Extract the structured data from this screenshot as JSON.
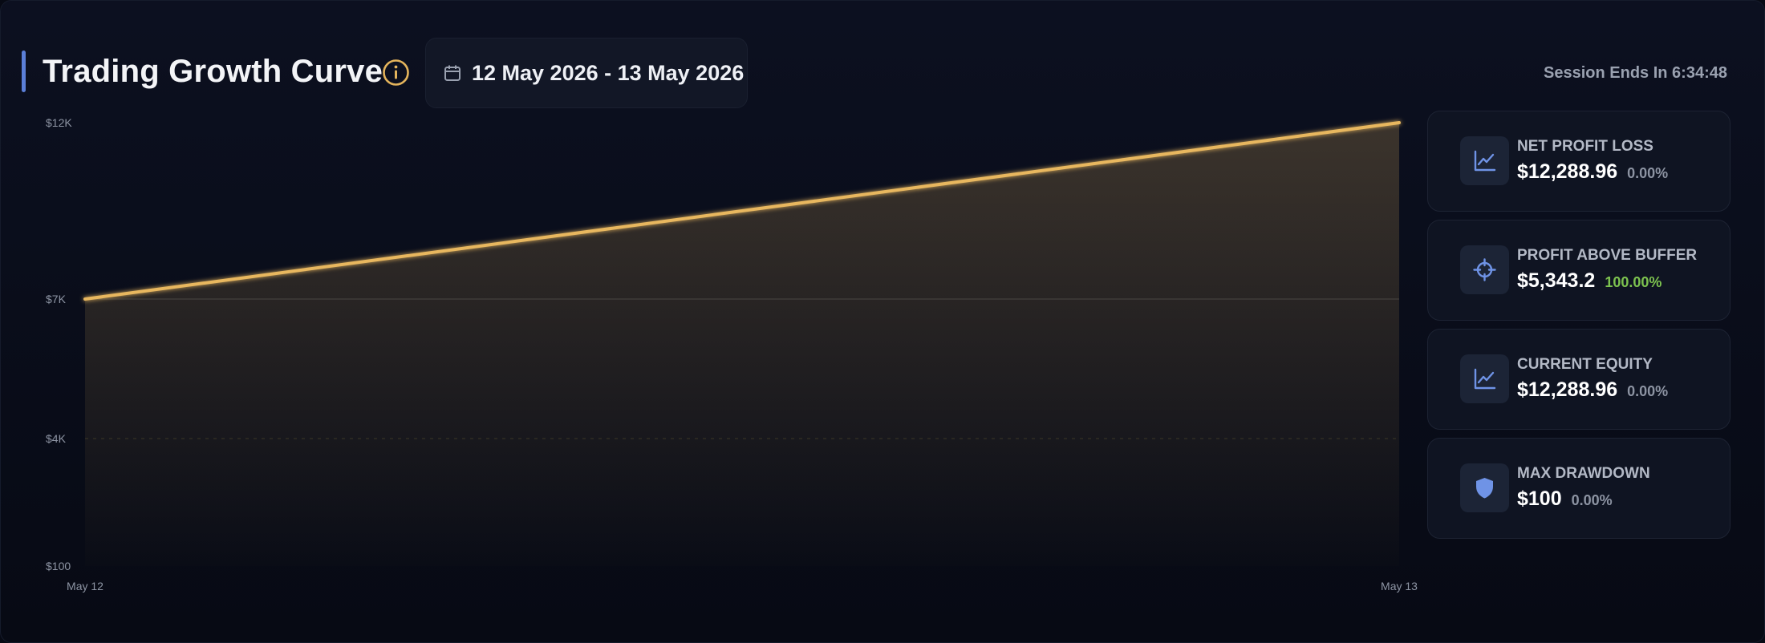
{
  "header": {
    "title": "Trading Growth Curve",
    "date_range": "12 May 2026 - 13 May 2026",
    "session_text": "Session Ends In 6:34:48"
  },
  "chart_data": {
    "type": "area",
    "x": [
      "May 12",
      "May 13"
    ],
    "series": [
      {
        "values": [
          7000,
          12000
        ]
      }
    ],
    "y_ticks": [
      "$12K",
      "$7K",
      "$4K",
      "$100"
    ],
    "x_ticks": [
      "May 12",
      "May 13"
    ],
    "ylim": [
      100,
      12000
    ],
    "line_color": "#e8b75e"
  },
  "stats": [
    {
      "label": "NET PROFIT LOSS",
      "value": "$12,288.96",
      "change": "0.00%",
      "icon": "line-chart-icon"
    },
    {
      "label": "PROFIT ABOVE BUFFER",
      "value": "$5,343.2",
      "change": "100.00%",
      "icon": "crosshair-icon",
      "positive": true
    },
    {
      "label": "CURRENT EQUITY",
      "value": "$12,288.96",
      "change": "0.00%",
      "icon": "line-chart-icon"
    },
    {
      "label": "MAX DRAWDOWN",
      "value": "$100",
      "change": "0.00%",
      "icon": "shield-icon"
    }
  ],
  "colors": {
    "accent": "#5b7fd8",
    "gold": "#e8b75e",
    "positive": "#7cc24f"
  }
}
